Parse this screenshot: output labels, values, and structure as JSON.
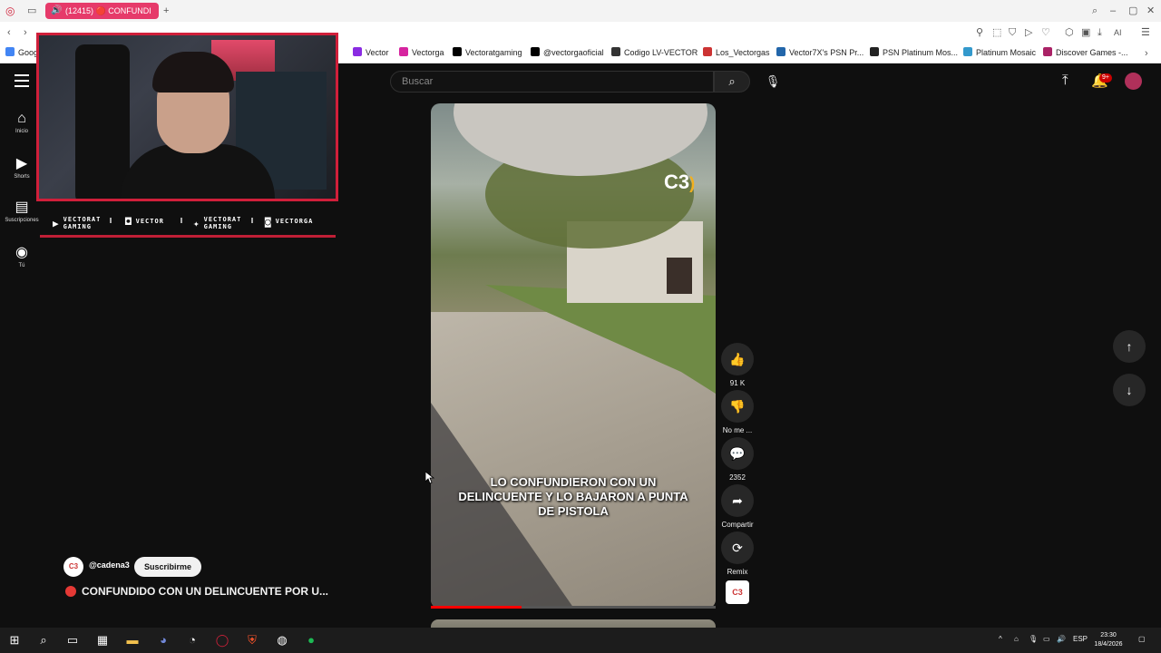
{
  "browser": {
    "tab_title": "(12415) 🔴 CONFUNDI",
    "address_text": "",
    "bookmarks": [
      {
        "label": "Goog",
        "color": "#4285f4"
      },
      {
        "label": "Vector",
        "color": "#8a2be2"
      },
      {
        "label": "Vectorga",
        "color": "#d6249f"
      },
      {
        "label": "Vectoratgaming",
        "color": "#000000"
      },
      {
        "label": "@vectorgaoficial",
        "color": "#000000"
      },
      {
        "label": "Codigo LV-VECTOR",
        "color": "#333333"
      },
      {
        "label": "Los_Vectorgas",
        "color": "#cc3333"
      },
      {
        "label": "Vector7X's PSN Pr...",
        "color": "#2266aa"
      },
      {
        "label": "PSN Platinum Mos...",
        "color": "#222222"
      },
      {
        "label": "Platinum Mosaic",
        "color": "#3399cc"
      },
      {
        "label": "Discover Games -...",
        "color": "#aa2266"
      }
    ]
  },
  "sidebar": {
    "items": [
      {
        "label": "Inicio",
        "icon": "home-icon"
      },
      {
        "label": "Shorts",
        "icon": "shorts-icon"
      },
      {
        "label": "Suscripciones",
        "icon": "subscriptions-icon"
      },
      {
        "label": "Tú",
        "icon": "user-icon"
      }
    ]
  },
  "overlay": {
    "socials": [
      {
        "label": "VECTORAT GAMING",
        "icon": "youtube-icon"
      },
      {
        "label": "VECTOR",
        "icon": "twitch-icon"
      },
      {
        "label": "VECTORAT GAMING",
        "icon": "twitter-icon"
      },
      {
        "label": "VECTORGA",
        "icon": "instagram-icon"
      }
    ]
  },
  "header": {
    "search_placeholder": "Buscar",
    "notification_count": "9+"
  },
  "short": {
    "caption": "LO CONFUNDIERON CON UN DELINCUENTE Y LO BAJARON A PUNTA DE PISTOLA",
    "watermark": "C3",
    "progress_fraction": 0.32,
    "channel_handle": "@cadena3",
    "subscribe_label": "Suscribirme",
    "title": "CONFUNDIDO CON UN DELINCUENTE POR U...",
    "channel_logo_text": "C3"
  },
  "actions": {
    "like_count": "91 K",
    "dislike_label": "No me ...",
    "comments_count": "2352",
    "share_label": "Compartir",
    "remix_label": "Remix"
  },
  "taskbar": {
    "language": "ESP",
    "time": "23:30",
    "date": "18/4/2026"
  }
}
